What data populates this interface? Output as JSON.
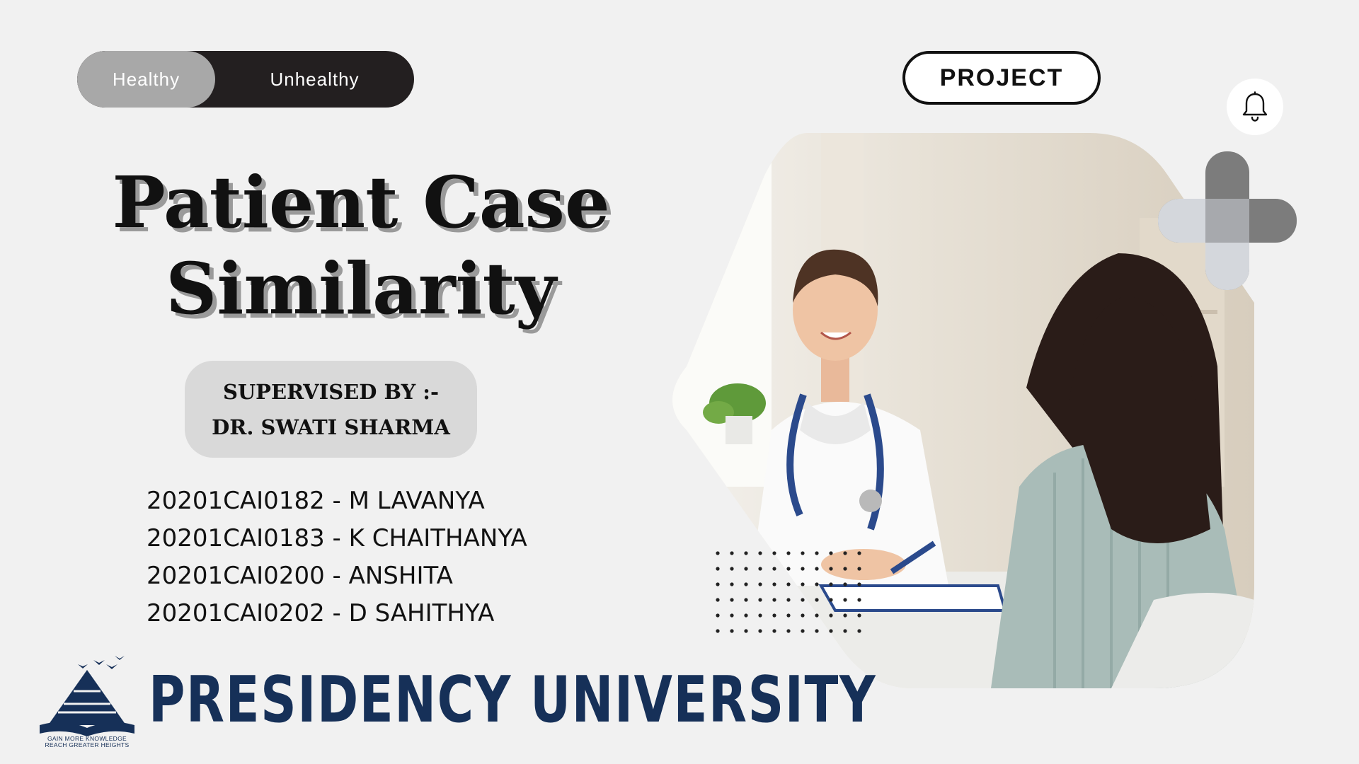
{
  "toggle": {
    "options": [
      "Healthy",
      "Unhealthy"
    ],
    "active": "Healthy"
  },
  "header": {
    "badge": "PROJECT"
  },
  "title": {
    "line1": "Patient Case",
    "line2": "Similarity"
  },
  "supervisor": {
    "label": "SUPERVISED BY :-",
    "name": "DR. SWATI SHARMA"
  },
  "members": [
    "20201CAI0182 - M LAVANYA",
    "20201CAI0183 - K CHAITHANYA",
    "20201CAI0200 - ANSHITA",
    "20201CAI0202 - D SAHITHYA"
  ],
  "university": {
    "name": "PRESIDENCY UNIVERSITY",
    "tagline_line1": "GAIN  MORE  KNOWLEDGE",
    "tagline_line2": "REACH GREATER HEIGHTS"
  },
  "icons": {
    "notification": "bell-icon",
    "decor": "plus-icon"
  },
  "colors": {
    "background": "#f1f1f1",
    "toggle_dark": "#231f20",
    "toggle_active": "#a8a8a8",
    "brand_navy": "#163058"
  }
}
